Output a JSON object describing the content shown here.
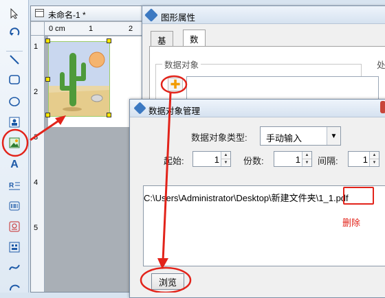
{
  "document": {
    "title": "未命名-1 *"
  },
  "ruler": {
    "h_labels": [
      "0 cm",
      "1",
      "2"
    ],
    "v_labels": [
      "1",
      "2",
      "3",
      "4",
      "5"
    ]
  },
  "graphic_props_dialog": {
    "title": "图形属性",
    "tabs": [
      {
        "label": "基本",
        "active": false
      },
      {
        "label": "数据源",
        "active": true
      }
    ],
    "data_object_label": "数据对象",
    "right_group_label": "处"
  },
  "data_object_dialog": {
    "title": "数据对象管理",
    "type_label": "数据对象类型:",
    "type_value": "手动输入",
    "start_label": "起始:",
    "start_value": "1",
    "copies_label": "份数:",
    "copies_value": "1",
    "interval_label": "间隔:",
    "interval_value": "1",
    "path_value": "C:\\Users\\Administrator\\Desktop\\新建文件夹\\1_1.pdf",
    "browse_label": "浏览"
  },
  "annotations": {
    "delete_note": "删除",
    "accent_color": "#e2231a"
  },
  "toolbar_icons": [
    "select-icon",
    "rotate-icon",
    "line-icon",
    "rounded-rect-icon",
    "ellipse-icon",
    "image-icon",
    "picture-icon",
    "text-icon",
    "rich-text-icon",
    "barcode-icon",
    "stamp-icon",
    "grid-icon",
    "curve-icon",
    "arc-icon"
  ]
}
